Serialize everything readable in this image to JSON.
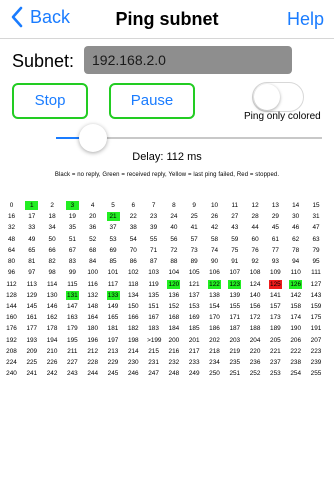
{
  "nav": {
    "back_label": "Back",
    "title": "Ping subnet",
    "help_label": "Help"
  },
  "subnet": {
    "label": "Subnet:",
    "value": "192.168.2.0"
  },
  "buttons": {
    "stop": "Stop",
    "pause": "Pause"
  },
  "toggle": {
    "label": "Ping only colored",
    "on": false
  },
  "slider": {
    "value_fraction": 0.14
  },
  "delay_text": "Delay: 112 ms",
  "legend": "Black = no reply, Green = received reply, Yellow = last ping failed, Red = stopped.",
  "grid": {
    "columns": 16,
    "labels": [
      "0",
      "1",
      "2",
      "3",
      "4",
      "5",
      "6",
      "7",
      "8",
      "9",
      "10",
      "11",
      "12",
      "13",
      "14",
      "15",
      "16",
      "17",
      "18",
      "19",
      "20",
      "21",
      "22",
      "23",
      "24",
      "25",
      "26",
      "27",
      "28",
      "29",
      "30",
      "31",
      "32",
      "33",
      "34",
      "35",
      "36",
      "37",
      "38",
      "39",
      "40",
      "41",
      "42",
      "43",
      "44",
      "45",
      "46",
      "47",
      "48",
      "49",
      "50",
      "51",
      "52",
      "53",
      "54",
      "55",
      "56",
      "57",
      "58",
      "59",
      "60",
      "61",
      "62",
      "63",
      "64",
      "65",
      "66",
      "67",
      "68",
      "69",
      "70",
      "71",
      "72",
      "73",
      "74",
      "75",
      "76",
      "77",
      "78",
      "79",
      "80",
      "81",
      "82",
      "83",
      "84",
      "85",
      "86",
      "87",
      "88",
      "89",
      "90",
      "91",
      "92",
      "93",
      "94",
      "95",
      "96",
      "97",
      "98",
      "99",
      "100",
      "101",
      "102",
      "103",
      "104",
      "105",
      "106",
      "107",
      "108",
      "109",
      "110",
      "111",
      "112",
      "113",
      "114",
      "115",
      "116",
      "117",
      "118",
      "119",
      "120",
      "121",
      "122",
      "123",
      "124",
      "125",
      "126",
      "127",
      "128",
      "129",
      "130",
      "131",
      "132",
      "133",
      "134",
      "135",
      "136",
      "137",
      "138",
      "139",
      "140",
      "141",
      "142",
      "143",
      "144",
      "145",
      "146",
      "147",
      "148",
      "149",
      "150",
      "151",
      "152",
      "153",
      "154",
      "155",
      "156",
      "157",
      "158",
      "159",
      "160",
      "161",
      "162",
      "163",
      "164",
      "165",
      "166",
      "167",
      "168",
      "169",
      "170",
      "171",
      "172",
      "173",
      "174",
      "175",
      "176",
      "177",
      "178",
      "179",
      "180",
      "181",
      "182",
      "183",
      "184",
      "185",
      "186",
      "187",
      "188",
      "189",
      "190",
      "191",
      "192",
      "193",
      "194",
      "195",
      "196",
      "197",
      "198",
      ">199",
      "200",
      "201",
      "202",
      "203",
      "204",
      "205",
      "206",
      "207",
      "208",
      "209",
      "210",
      "211",
      "212",
      "213",
      "214",
      "215",
      "216",
      "217",
      "218",
      "219",
      "220",
      "221",
      "222",
      "223",
      "224",
      "225",
      "226",
      "227",
      "228",
      "229",
      "230",
      "231",
      "232",
      "233",
      "234",
      "235",
      "236",
      "237",
      "238",
      "239",
      "240",
      "241",
      "242",
      "243",
      "244",
      "245",
      "246",
      "247",
      "248",
      "249",
      "250",
      "251",
      "252",
      "253",
      "254",
      "255"
    ],
    "green": [
      1,
      3,
      21,
      120,
      122,
      123,
      126,
      131,
      133
    ],
    "red": [
      125
    ],
    "colors": {
      "green": "#22ee22",
      "red": "#ee1c1c"
    }
  }
}
